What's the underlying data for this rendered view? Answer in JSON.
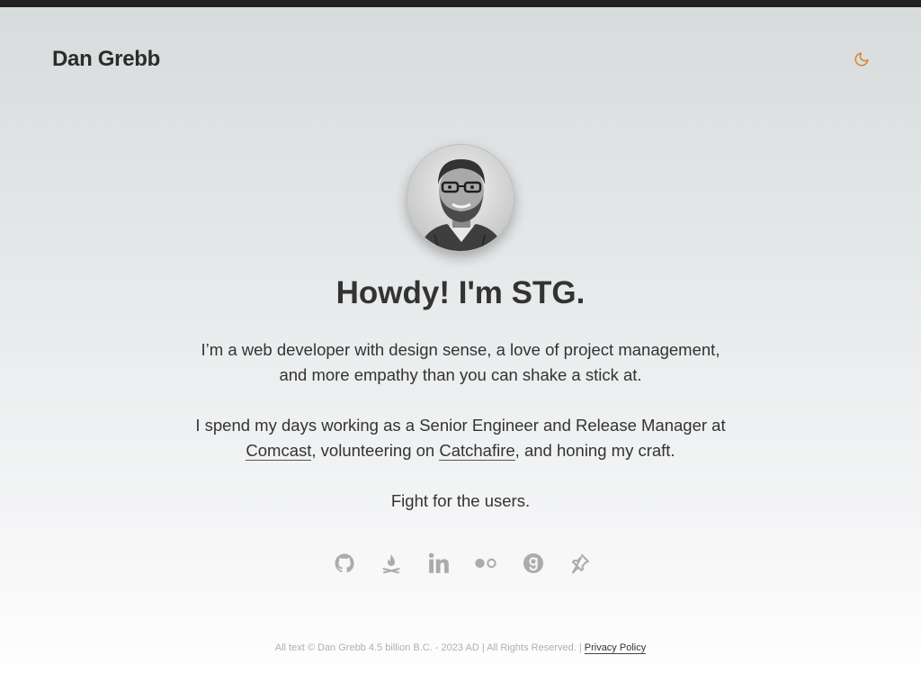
{
  "header": {
    "site_title": "Dan Grebb",
    "theme_toggle_icon": "moon-icon"
  },
  "hero": {
    "avatar_icon": "portrait-photo",
    "headline": "Howdy! I'm STG.",
    "intro": "I’m a web developer with design sense, a love of project management, and more empathy than you can shake a stick at.",
    "work_before": "I spend my days working as a Senior Engineer and Release Manager at ",
    "work_link_1": "Comcast",
    "work_middle": ", volunteering on ",
    "work_link_2": "Catchafire",
    "work_after": ", and honing my craft.",
    "motto": "Fight for the users."
  },
  "social": {
    "icons": [
      "github-icon",
      "campfire-icon",
      "linkedin-icon",
      "flickr-icon",
      "goodreads-icon",
      "pinboard-icon"
    ]
  },
  "footer": {
    "copyright": "All text © Dan Grebb 4.5 billion B.C. - 2023 AD | All Rights Reserved. |",
    "privacy_link": "Privacy Policy"
  },
  "colors": {
    "accent": "#d9822b",
    "icon_gray": "#a9abad",
    "text": "#333333"
  }
}
